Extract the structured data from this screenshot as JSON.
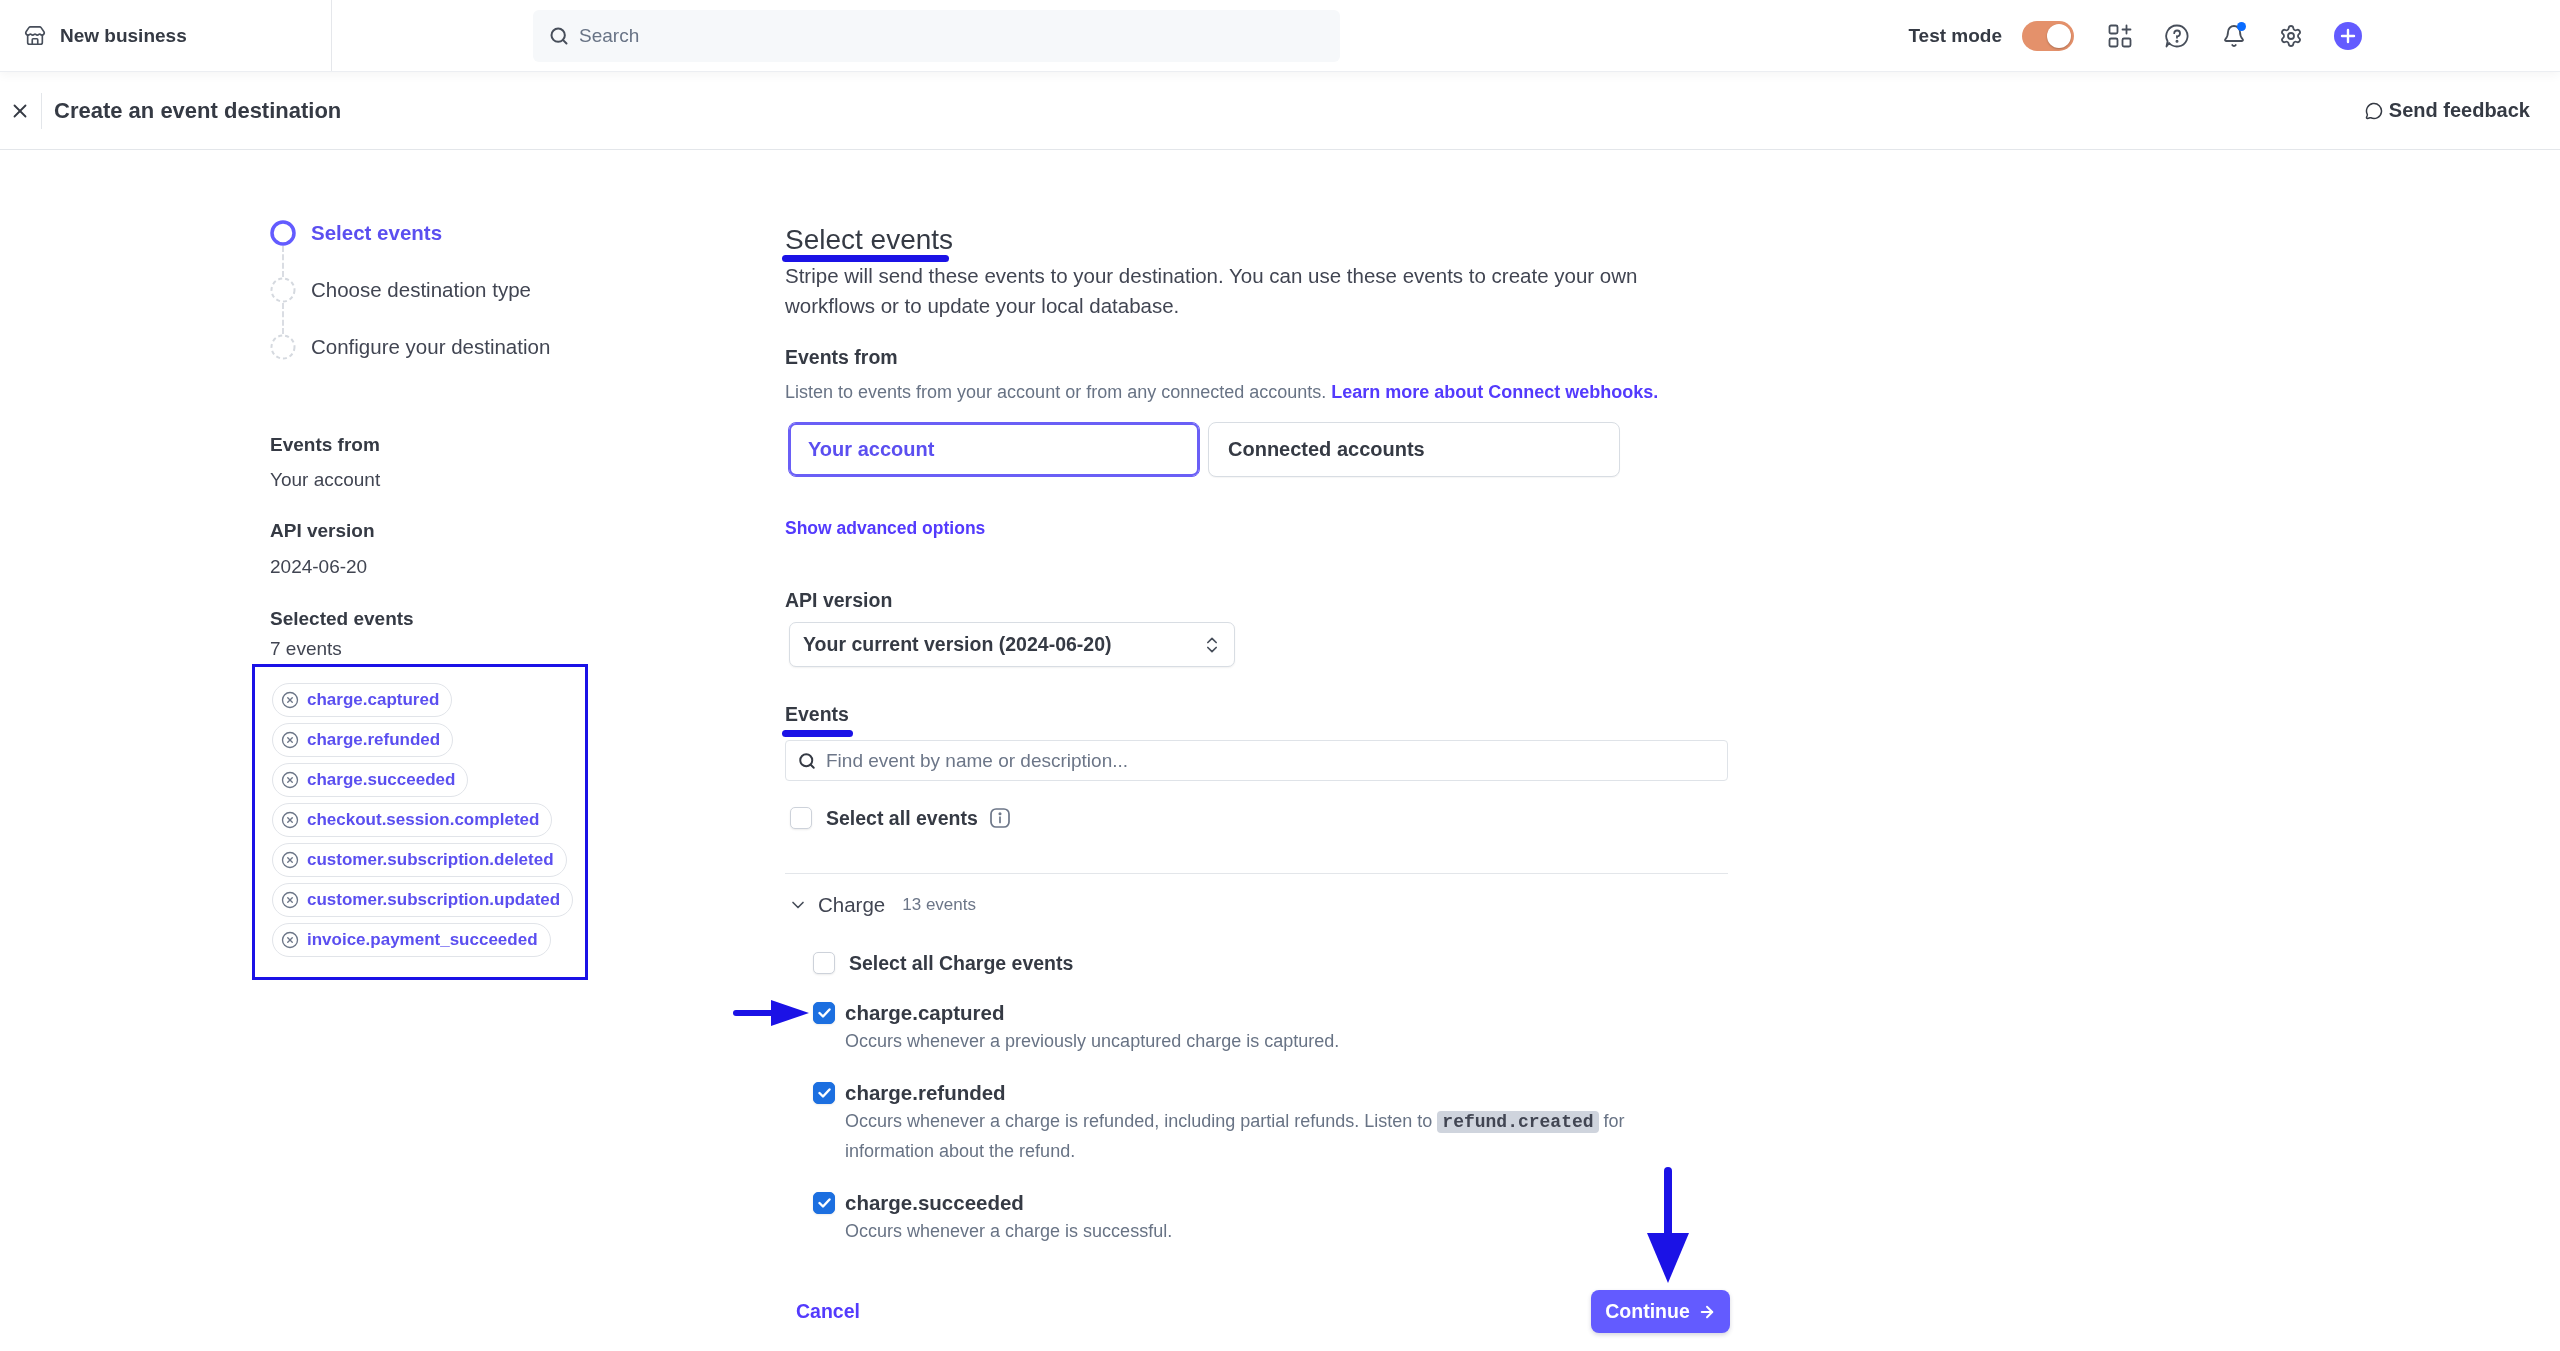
{
  "topbar": {
    "account": "New business",
    "search": {
      "placeholder": "Search"
    },
    "test_mode": {
      "label": "Test mode",
      "on": true
    },
    "notifications": {
      "unread": true
    }
  },
  "header": {
    "title": "Create an event destination",
    "feedback": "Send feedback"
  },
  "steps": [
    {
      "label": "Select events",
      "selected": true
    },
    {
      "label": "Choose destination type",
      "selected": false
    },
    {
      "label": "Configure your destination",
      "selected": false
    }
  ],
  "summary": {
    "events_from": {
      "label": "Events from",
      "value": "Your account"
    },
    "api_version": {
      "label": "API version",
      "value": "2024-06-20"
    },
    "selected_events": {
      "label": "Selected events",
      "count": "7 events",
      "annotated": true,
      "chips": [
        "charge.captured",
        "charge.refunded",
        "charge.succeeded",
        "checkout.session.completed",
        "customer.subscription.deleted",
        "customer.subscription.updated",
        "invoice.payment_succeeded"
      ]
    }
  },
  "main": {
    "title": {
      "text": "Select events",
      "annotated": true
    },
    "description": "Stripe will send these events to your destination. You can use these events to create your own workflows or to update your local database.",
    "events_from": {
      "label": "Events from",
      "hint": "Listen to events from your account or from any connected accounts.",
      "link": "Learn more about Connect webhooks.",
      "options": [
        {
          "label": "Your account",
          "selected": true
        },
        {
          "label": "Connected accounts",
          "selected": false
        }
      ]
    },
    "advanced_link": "Show advanced options",
    "api_version": {
      "label": "API version",
      "value": "Your current version (2024-06-20)"
    },
    "events": {
      "label": {
        "text": "Events",
        "annotated": true
      },
      "search": {
        "placeholder": "Find event by name or description..."
      },
      "select_all": {
        "label": "Select all events",
        "checked": false
      },
      "groups": [
        {
          "name": "Charge",
          "count": "13 events",
          "expanded": true,
          "select_all": {
            "label": "Select all Charge events",
            "checked": false
          },
          "items": [
            {
              "name": "charge.captured",
              "checked": true,
              "annotated": true,
              "description": [
                {
                  "kind": "text",
                  "text": "Occurs whenever a previously uncaptured charge is captured."
                }
              ]
            },
            {
              "name": "charge.refunded",
              "checked": true,
              "annotated": false,
              "description": [
                {
                  "kind": "text",
                  "text": "Occurs whenever a charge is refunded, including partial refunds. Listen to "
                },
                {
                  "kind": "code",
                  "text": "refund.created"
                },
                {
                  "kind": "text",
                  "text": " for information about the refund."
                }
              ]
            },
            {
              "name": "charge.succeeded",
              "checked": true,
              "annotated": false,
              "description": [
                {
                  "kind": "text",
                  "text": "Occurs whenever a charge is successful."
                }
              ]
            }
          ]
        }
      ]
    }
  },
  "footer": {
    "cancel": "Cancel",
    "continue": {
      "label": "Continue",
      "annotated": true
    }
  }
}
